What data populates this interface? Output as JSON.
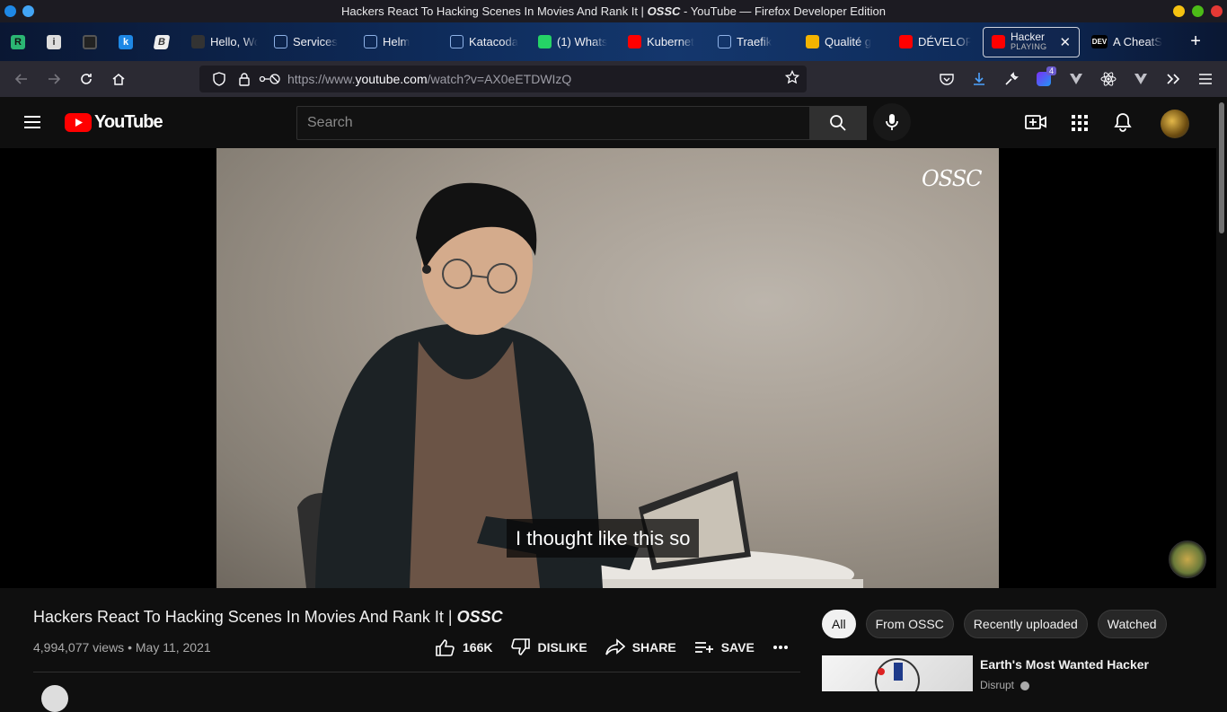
{
  "window": {
    "title_prefix": "Hackers React To Hacking Scenes In Movies And Rank It |",
    "title_brand": "OSSC",
    "title_suffix": "- YouTube — Firefox Developer Edition"
  },
  "tabs": [
    {
      "label": "Hello, Wo",
      "fav_color": "#333"
    },
    {
      "label": "Services",
      "fav_color": "transparent"
    },
    {
      "label": "Helm",
      "fav_color": "transparent"
    },
    {
      "label": "Katacoda",
      "fav_color": "transparent"
    },
    {
      "label": "(1) Whats",
      "fav_color": "#25d366"
    },
    {
      "label": "Kubernet",
      "fav_color": "#ff0000"
    },
    {
      "label": "Traefik",
      "fav_color": "transparent"
    },
    {
      "label": "Qualité g",
      "fav_color": "#f4b400"
    },
    {
      "label": "DÉVELOP",
      "fav_color": "#ff0000"
    }
  ],
  "active_tab": {
    "label": "Hacker",
    "sub": "PLAYING"
  },
  "last_tab": {
    "label": "A CheatS",
    "fav": "DEV"
  },
  "url": {
    "prefix": "https://www.",
    "domain": "youtube.com",
    "path": "/watch?v=AX0eETDWIzQ"
  },
  "extension_badge": "4",
  "youtube": {
    "logo_text": "YouTube",
    "search_placeholder": "Search"
  },
  "video": {
    "caption": "I thought like this so",
    "watermark": "OSSC",
    "title_text": "Hackers React To Hacking Scenes In Movies And Rank It |",
    "title_brand": "OSSC",
    "views": "4,994,077 views",
    "date": "May 11, 2021",
    "likes": "166K",
    "dislike_label": "DISLIKE",
    "share_label": "SHARE",
    "save_label": "SAVE"
  },
  "chips": [
    "All",
    "From OSSC",
    "Recently uploaded",
    "Watched"
  ],
  "recommendation": {
    "title": "Earth's Most Wanted Hacker",
    "channel": "Disrupt"
  }
}
